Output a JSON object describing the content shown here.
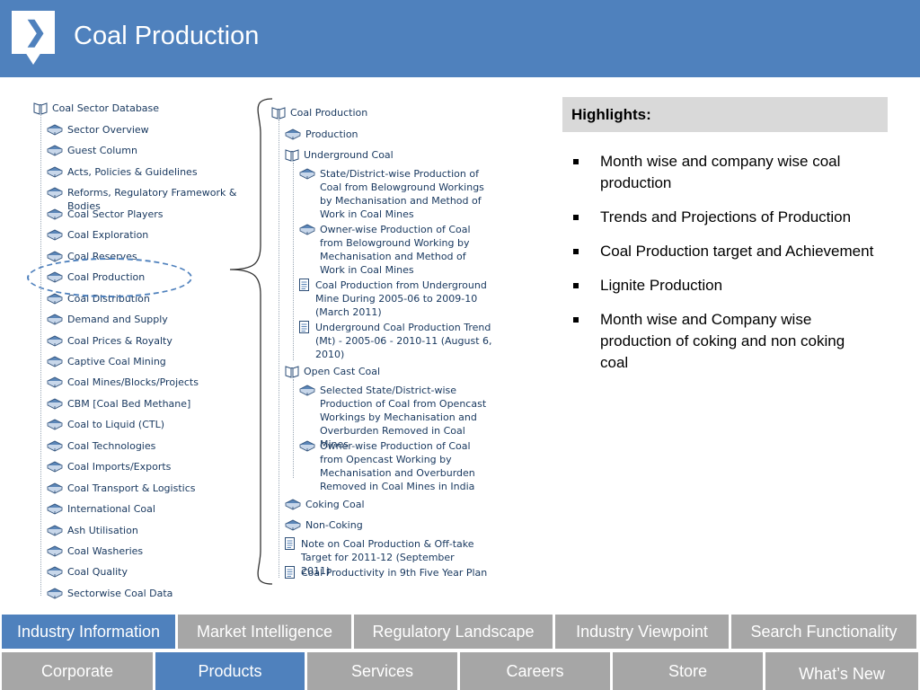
{
  "header": {
    "title": "Coal Production",
    "accent": "#4f81bd"
  },
  "left_tree": {
    "root": "Coal Sector Database",
    "items": [
      "Sector Overview",
      "Guest Column",
      "Acts, Policies & Guidelines",
      "Reforms, Regulatory Framework & Bodies",
      "Coal Sector Players",
      "Coal Exploration",
      "Coal Reserves",
      "Coal Production",
      "Coal Distribution",
      "Demand and Supply",
      "Coal Prices & Royalty",
      "Captive Coal Mining",
      "Coal Mines/Blocks/Projects",
      "CBM [Coal Bed Methane]",
      "Coal to Liquid (CTL)",
      "Coal Technologies",
      "Coal Imports/Exports",
      "Coal Transport & Logistics",
      "International Coal",
      "Ash Utilisation",
      "Coal Washeries",
      "Coal Quality",
      "Sectorwise Coal Data"
    ]
  },
  "right_tree": {
    "root": "Coal Production",
    "production": "Production",
    "underground": {
      "label": "Underground Coal",
      "items": [
        "State/District-wise Production of Coal from Belowground Workings by Mechanisation and Method of Work in Coal Mines",
        "Owner-wise Production of Coal from Belowground Working by Mechanisation and Method of Work in Coal Mines",
        "Coal Production from Underground Mine During 2005-06 to 2009-10 (March 2011)",
        "Underground Coal Production Trend (Mt) - 2005-06 - 2010-11 (August 6, 2010)"
      ]
    },
    "opencast": {
      "label": "Open Cast Coal",
      "items": [
        "Selected State/District-wise Production of Coal from Opencast Workings by Mechanisation and Overburden Removed in Coal Mines",
        "Owner-wise Production of Coal from Opencast Working by Mechanisation and Overburden Removed in Coal Mines in India"
      ]
    },
    "coking": "Coking Coal",
    "non_coking": "Non-Coking",
    "note": "Note on Coal Production & Off-take Target for 2011-12 (September 2011)",
    "productivity": "Coal Productivity in 9th Five Year Plan"
  },
  "highlights": {
    "title": "Highlights:",
    "bullets": [
      "Month wise and company wise coal production",
      "Trends and Projections of Production",
      "Coal Production target and Achievement",
      "Lignite Production",
      "Month wise and Company wise production of coking and non coking coal"
    ]
  },
  "nav_primary": [
    "Industry Information",
    "Market Intelligence",
    "Regulatory Landscape",
    "Industry Viewpoint",
    "Search Functionality"
  ],
  "nav_secondary": [
    "Corporate",
    "Products",
    "Services",
    "Careers",
    "Store",
    "What’s New"
  ]
}
